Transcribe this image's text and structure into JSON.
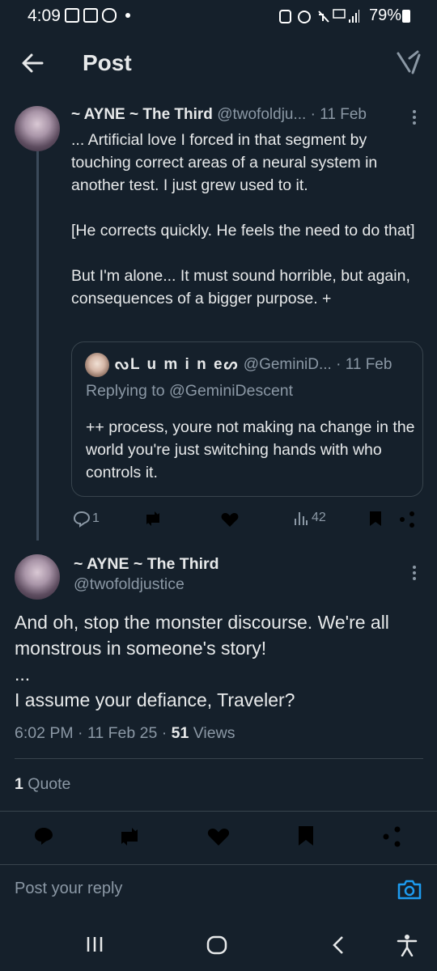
{
  "status_bar": {
    "time": "4:09",
    "battery": "79%"
  },
  "header": {
    "title": "Post"
  },
  "tweet1": {
    "name": "~ AYNE ~ The Third",
    "handle": "@twofoldju...",
    "date": "· 11 Feb",
    "paragraphs": [
      "... Artificial love I forced in that segment by touching correct areas of a neural system in another test. I  just grew used to it.",
      "[He corrects quickly. He feels the need to do that]",
      "But I'm alone... It must sound horrible, but again, consequences of a bigger purpose. +"
    ],
    "quote": {
      "name": "ᔓL u m i n eᔕ",
      "handle": "@GeminiD...",
      "date": "· 11 Feb",
      "replying": "Replying to @GeminiDescent",
      "text": "++ process, youre not making na change in the world you're just switching hands with who controls it."
    },
    "stats": {
      "replies": "1",
      "views": "42"
    }
  },
  "tweet2": {
    "name": "~ AYNE ~ The Third",
    "handle": "@twofoldjustice",
    "lines": [
      "And oh, stop the monster discourse. We're all monstrous in someone's story!",
      "...",
      "I assume your defiance, Traveler?"
    ],
    "time_date": "6:02 PM · 11 Feb 25 · ",
    "views_count": "51",
    "views_label": " Views",
    "quotes_count": "1",
    "quotes_label": " Quote"
  },
  "reply": {
    "placeholder": "Post your reply"
  },
  "colors": {
    "background": "#15202b",
    "muted": "#8b98a5",
    "accent": "#1d9bf0"
  }
}
